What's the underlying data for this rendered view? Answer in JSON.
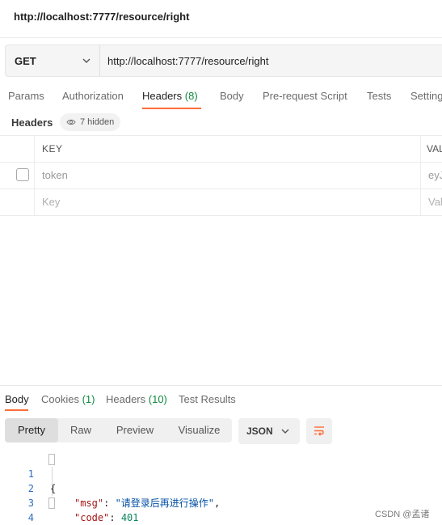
{
  "request": {
    "title": "http://localhost:7777/resource/right",
    "method": "GET",
    "url": "http://localhost:7777/resource/right"
  },
  "request_tabs": [
    {
      "label": "Params"
    },
    {
      "label": "Authorization"
    },
    {
      "label": "Headers",
      "count": "(8)",
      "active": true
    },
    {
      "label": "Body"
    },
    {
      "label": "Pre-request Script"
    },
    {
      "label": "Tests"
    },
    {
      "label": "Settings"
    }
  ],
  "headers_section": {
    "label": "Headers",
    "hidden_label": "7 hidden",
    "col_key": "KEY",
    "col_value": "VALUE",
    "row": {
      "key": "token",
      "value": "eyJ"
    },
    "placeholder_key": "Key",
    "placeholder_value": "Value"
  },
  "response_tabs": [
    {
      "label": "Body",
      "active": true
    },
    {
      "label": "Cookies",
      "count": "(1)"
    },
    {
      "label": "Headers",
      "count": "(10)"
    },
    {
      "label": "Test Results"
    }
  ],
  "view_modes": [
    "Pretty",
    "Raw",
    "Preview",
    "Visualize"
  ],
  "active_view": "Pretty",
  "format": "JSON",
  "code_lines": [
    {
      "n": "1",
      "text": "{"
    },
    {
      "n": "2",
      "key": "\"msg\"",
      "value": "\"请登录后再进行操作\""
    },
    {
      "n": "3",
      "key": "\"code\"",
      "value": "401"
    },
    {
      "n": "4",
      "text": "}"
    }
  ],
  "watermark": "CSDN @孟诸",
  "colors": {
    "accent": "#ff6c37",
    "count_green": "#0f8a3e",
    "line_number": "#2d6cbf",
    "json_key": "#a31515",
    "json_string": "#0451a5",
    "json_number": "#098658"
  },
  "icons": [
    "chevron-down-icon",
    "eye-icon",
    "wrap-lines-icon"
  ]
}
